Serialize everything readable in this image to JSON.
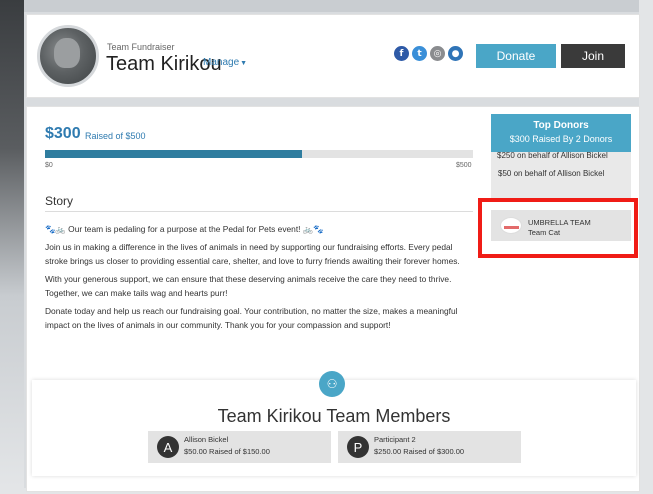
{
  "header": {
    "fundraiser_label": "Team Fundraiser",
    "team_name": "Team Kirikou",
    "manage_label": "Manage",
    "donate_label": "Donate",
    "join_label": "Join",
    "social_icons": [
      "facebook-icon",
      "twitter-icon",
      "instagram-icon",
      "message-icon"
    ]
  },
  "progress": {
    "raised_amount": "$300",
    "raised_of": "Raised of $500",
    "min_label": "$0",
    "max_label": "$500",
    "fraction": 0.6
  },
  "story": {
    "heading": "Story",
    "paragraphs": [
      "🐾🚲 Our team is pedaling for a purpose at the Pedal for Pets event! 🚲🐾",
      "Join us in making a difference in the lives of animals in need by supporting our fundraising efforts. Every pedal stroke brings us closer to providing essential care, shelter, and love to furry friends awaiting their forever homes.",
      "With your generous support, we can ensure that these deserving animals receive the care they need to thrive. Together, we can make tails wag and hearts purr!",
      "Donate today and help us reach our fundraising goal. Your contribution, no matter the size, makes a meaningful impact on the lives of animals in our community. Thank you for your compassion and support!"
    ]
  },
  "top_donors": {
    "title": "Top Donors",
    "subtitle": "$300 Raised By 2 Donors",
    "donors": [
      "$250 on behalf of Allison Bickel",
      "$50 on behalf of Allison Bickel"
    ],
    "team": {
      "name": "UMBRELLA TEAM",
      "sub": "Team Cat"
    }
  },
  "members": {
    "title": "Team Kirikou Team Members",
    "list": [
      {
        "initial": "A",
        "name": "Allison Bickel",
        "amount": "$50.00 Raised of $150.00"
      },
      {
        "initial": "P",
        "name": "Participant 2",
        "amount": "$250.00 Raised of $300.00"
      }
    ]
  },
  "colors": {
    "accent": "#4aa6c7",
    "progress": "#2f7d9f",
    "link": "#2f7bb0",
    "highlight": "#f01c16"
  }
}
